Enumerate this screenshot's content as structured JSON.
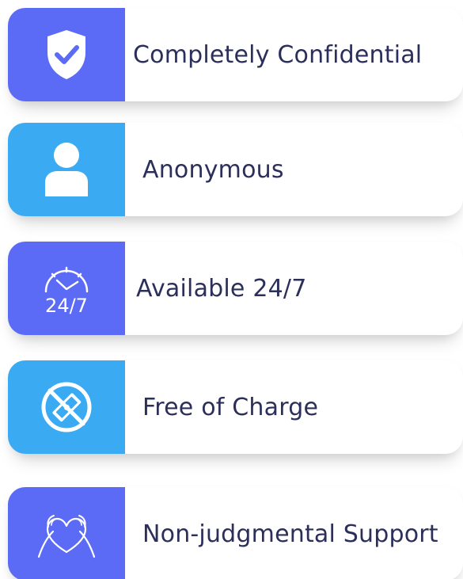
{
  "features": [
    {
      "label": "Completely Confidential",
      "icon": "shield-check-icon"
    },
    {
      "label": "Anonymous",
      "icon": "person-icon"
    },
    {
      "label": "Available 24/7",
      "icon": "clock-24-7-icon",
      "icon_text": "24/7"
    },
    {
      "label": "Free of Charge",
      "icon": "no-money-icon"
    },
    {
      "label": "Non-judgmental Support",
      "icon": "heart-hands-icon"
    }
  ],
  "colors": {
    "indigo": "#5b6bf5",
    "sky": "#3aaaf3",
    "text": "#2b2f5a"
  }
}
